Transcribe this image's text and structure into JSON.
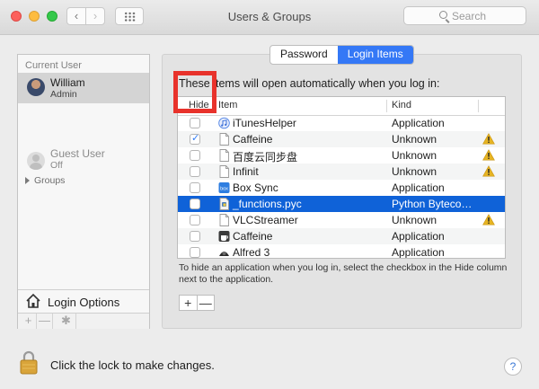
{
  "window": {
    "title": "Users & Groups"
  },
  "toolbar": {
    "back_glyph": "‹",
    "forward_glyph": "›",
    "search_placeholder": "Search"
  },
  "sidebar": {
    "section_label": "Current User",
    "current_user": {
      "name": "William",
      "role": "Admin"
    },
    "guest": {
      "name": "Guest User",
      "status": "Off"
    },
    "groups_label": "Groups",
    "login_options_label": "Login Options",
    "buttons": {
      "add": "+",
      "remove": "—",
      "gear": "✱"
    }
  },
  "tabs": [
    {
      "label": "Password",
      "active": false
    },
    {
      "label": "Login Items",
      "active": true
    }
  ],
  "login_items": {
    "intro": "These items will open automatically when you log in:",
    "columns": {
      "hide": "Hide",
      "item": "Item",
      "kind": "Kind"
    },
    "rows": [
      {
        "name": "iTunesHelper",
        "kind": "Application",
        "checked": false,
        "warning": false,
        "selected": false,
        "icon": "itunes-icon"
      },
      {
        "name": "Caffeine",
        "kind": "Unknown",
        "checked": true,
        "warning": true,
        "selected": false,
        "icon": "document-icon"
      },
      {
        "name": "百度云同步盘",
        "kind": "Unknown",
        "checked": false,
        "warning": true,
        "selected": false,
        "icon": "document-icon"
      },
      {
        "name": "Infinit",
        "kind": "Unknown",
        "checked": false,
        "warning": true,
        "selected": false,
        "icon": "document-icon"
      },
      {
        "name": "Box Sync",
        "kind": "Application",
        "checked": false,
        "warning": false,
        "selected": false,
        "icon": "box-icon"
      },
      {
        "name": "_functions.pyc",
        "kind": "Python Byteco…",
        "checked": false,
        "warning": false,
        "selected": true,
        "icon": "python-file-icon"
      },
      {
        "name": "VLCStreamer",
        "kind": "Unknown",
        "checked": false,
        "warning": true,
        "selected": false,
        "icon": "document-icon"
      },
      {
        "name": "Caffeine",
        "kind": "Application",
        "checked": false,
        "warning": false,
        "selected": false,
        "icon": "caffeine-app-icon"
      },
      {
        "name": "Alfred 3",
        "kind": "Application",
        "checked": false,
        "warning": false,
        "selected": false,
        "icon": "alfred-icon"
      }
    ],
    "hint": "To hide an application when you log in, select the checkbox in the Hide column next to the application.",
    "add_label": "+",
    "remove_label": "—"
  },
  "footer": {
    "lock_text": "Click the lock to make changes.",
    "help_label": "?"
  },
  "colors": {
    "selection": "#0f62d8",
    "tab_active": "#3478f6",
    "highlight_box": "#e8322b",
    "warning": "#e6b422"
  }
}
